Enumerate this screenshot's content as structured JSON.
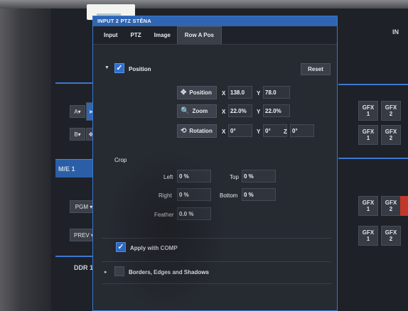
{
  "dialog": {
    "title": "INPUT 2 PTZ STĚNA",
    "tabs": [
      {
        "label": "Input",
        "active": false
      },
      {
        "label": "PTZ",
        "active": false
      },
      {
        "label": "Image",
        "active": false
      },
      {
        "label": "Row A Pos",
        "active": true
      }
    ],
    "position_section": {
      "label": "Position",
      "checked": true,
      "reset_label": "Reset",
      "rows": [
        {
          "button": "Position",
          "icon": "move-icon",
          "fields": [
            {
              "axis": "X",
              "value": "138.0"
            },
            {
              "axis": "Y",
              "value": "78.0"
            }
          ]
        },
        {
          "button": "Zoom",
          "icon": "zoom-icon",
          "fields": [
            {
              "axis": "X",
              "value": "22.0%"
            },
            {
              "axis": "Y",
              "value": "22.0%"
            }
          ]
        },
        {
          "button": "Rotation",
          "icon": "rotate-icon",
          "fields": [
            {
              "axis": "X",
              "value": "0°"
            },
            {
              "axis": "Y",
              "value": "0°"
            },
            {
              "axis": "Z",
              "value": "0°"
            }
          ]
        }
      ]
    },
    "crop": {
      "label": "Crop",
      "left_label": "Left",
      "left_value": "0 %",
      "top_label": "Top",
      "top_value": "0 %",
      "right_label": "Right",
      "right_value": "0 %",
      "bottom_label": "Bottom",
      "bottom_value": "0 %",
      "feather_label": "Feather",
      "feather_value": "0.0 %"
    },
    "apply_with_comp": {
      "label": "Apply with COMP",
      "checked": true
    },
    "borders": {
      "label": "Borders, Edges and Shadows",
      "checked": false
    }
  },
  "background": {
    "in_label": "IN",
    "a_label": "A▾",
    "b_label": "B▾",
    "me_label": "M/E 1",
    "pgm_label": "PGM ▾",
    "prev_label": "PREV ▾",
    "ddr_label": "DDR 1",
    "gfx_tiles": [
      {
        "l1": "GFX",
        "l2": "1"
      },
      {
        "l1": "GFX",
        "l2": "2"
      }
    ]
  },
  "colors": {
    "accent": "#2f65b2",
    "checkbox": "#2f6fd0",
    "panel": "#262a31"
  }
}
